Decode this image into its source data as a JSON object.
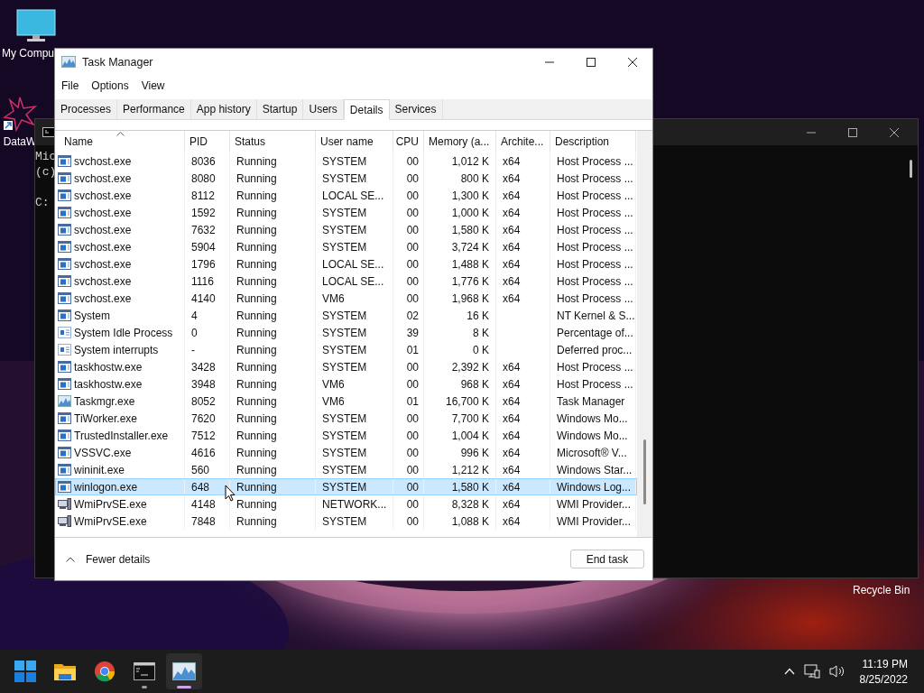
{
  "desktop": {
    "kind": "picture",
    "icons": [
      {
        "label": "My Compu",
        "kind": "monitor"
      },
      {
        "label": "DataW",
        "kind": "shortcut"
      },
      {
        "label": "Recycle Bin",
        "kind": "hidden"
      }
    ]
  },
  "console": {
    "lines": [
      "Mic",
      "(c)",
      "C:"
    ]
  },
  "task_manager": {
    "title": "Task Manager",
    "menu": [
      "File",
      "Options",
      "View"
    ],
    "tabs": [
      {
        "label": "Processes",
        "selected": false
      },
      {
        "label": "Performance",
        "selected": false
      },
      {
        "label": "App history",
        "selected": false
      },
      {
        "label": "Startup",
        "selected": false
      },
      {
        "label": "Users",
        "selected": false
      },
      {
        "label": "Details",
        "selected": true
      },
      {
        "label": "Services",
        "selected": false
      }
    ],
    "columns": [
      "Name",
      "PID",
      "Status",
      "User name",
      "CPU",
      "Memory (a...",
      "Archite...",
      "Description"
    ],
    "rows": [
      {
        "kind": "service",
        "name": "svchost.exe",
        "pid": "8036",
        "status": "Running",
        "user": "SYSTEM",
        "cpu": "00",
        "memory": "1,012 K",
        "arch": "x64",
        "description": "Host Process ...",
        "selected": false
      },
      {
        "kind": "service",
        "name": "svchost.exe",
        "pid": "8080",
        "status": "Running",
        "user": "SYSTEM",
        "cpu": "00",
        "memory": "800 K",
        "arch": "x64",
        "description": "Host Process ...",
        "selected": false
      },
      {
        "kind": "service",
        "name": "svchost.exe",
        "pid": "8112",
        "status": "Running",
        "user": "LOCAL SE...",
        "cpu": "00",
        "memory": "1,300 K",
        "arch": "x64",
        "description": "Host Process ...",
        "selected": false
      },
      {
        "kind": "service",
        "name": "svchost.exe",
        "pid": "1592",
        "status": "Running",
        "user": "SYSTEM",
        "cpu": "00",
        "memory": "1,000 K",
        "arch": "x64",
        "description": "Host Process ...",
        "selected": false
      },
      {
        "kind": "service",
        "name": "svchost.exe",
        "pid": "7632",
        "status": "Running",
        "user": "SYSTEM",
        "cpu": "00",
        "memory": "1,580 K",
        "arch": "x64",
        "description": "Host Process ...",
        "selected": false
      },
      {
        "kind": "service",
        "name": "svchost.exe",
        "pid": "5904",
        "status": "Running",
        "user": "SYSTEM",
        "cpu": "00",
        "memory": "3,724 K",
        "arch": "x64",
        "description": "Host Process ...",
        "selected": false
      },
      {
        "kind": "service",
        "name": "svchost.exe",
        "pid": "1796",
        "status": "Running",
        "user": "LOCAL SE...",
        "cpu": "00",
        "memory": "1,488 K",
        "arch": "x64",
        "description": "Host Process ...",
        "selected": false
      },
      {
        "kind": "service",
        "name": "svchost.exe",
        "pid": "1116",
        "status": "Running",
        "user": "LOCAL SE...",
        "cpu": "00",
        "memory": "1,776 K",
        "arch": "x64",
        "description": "Host Process ...",
        "selected": false
      },
      {
        "kind": "service",
        "name": "svchost.exe",
        "pid": "4140",
        "status": "Running",
        "user": "VM6",
        "cpu": "00",
        "memory": "1,968 K",
        "arch": "x64",
        "description": "Host Process ...",
        "selected": false
      },
      {
        "kind": "service",
        "name": "System",
        "pid": "4",
        "status": "Running",
        "user": "SYSTEM",
        "cpu": "02",
        "memory": "16 K",
        "description": "NT Kernel & S...",
        "selected": false
      },
      {
        "kind": "light",
        "name": "System Idle Process",
        "pid": "0",
        "status": "Running",
        "user": "SYSTEM",
        "cpu": "39",
        "memory": "8 K",
        "description": "Percentage of...",
        "selected": false
      },
      {
        "kind": "light",
        "name": "System interrupts",
        "pid": "-",
        "status": "Running",
        "user": "SYSTEM",
        "cpu": "01",
        "memory": "0 K",
        "description": "Deferred proc...",
        "selected": false
      },
      {
        "kind": "service",
        "name": "taskhostw.exe",
        "pid": "3428",
        "status": "Running",
        "user": "SYSTEM",
        "cpu": "00",
        "memory": "2,392 K",
        "arch": "x64",
        "description": "Host Process ...",
        "selected": false
      },
      {
        "kind": "service",
        "name": "taskhostw.exe",
        "pid": "3948",
        "status": "Running",
        "user": "VM6",
        "cpu": "00",
        "memory": "968 K",
        "arch": "x64",
        "description": "Host Process ...",
        "selected": false
      },
      {
        "kind": "chart",
        "name": "Taskmgr.exe",
        "pid": "8052",
        "status": "Running",
        "user": "VM6",
        "cpu": "01",
        "memory": "16,700 K",
        "arch": "x64",
        "description": "Task Manager",
        "selected": false
      },
      {
        "kind": "service",
        "name": "TiWorker.exe",
        "pid": "7620",
        "status": "Running",
        "user": "SYSTEM",
        "cpu": "00",
        "memory": "7,700 K",
        "arch": "x64",
        "description": "Windows Mo...",
        "selected": false
      },
      {
        "kind": "service",
        "name": "TrustedInstaller.exe",
        "pid": "7512",
        "status": "Running",
        "user": "SYSTEM",
        "cpu": "00",
        "memory": "1,004 K",
        "arch": "x64",
        "description": "Windows Mo...",
        "selected": false
      },
      {
        "kind": "service",
        "name": "VSSVC.exe",
        "pid": "4616",
        "status": "Running",
        "user": "SYSTEM",
        "cpu": "00",
        "memory": "996 K",
        "arch": "x64",
        "description": "Microsoft® V...",
        "selected": false
      },
      {
        "kind": "service",
        "name": "wininit.exe",
        "pid": "560",
        "status": "Running",
        "user": "SYSTEM",
        "cpu": "00",
        "memory": "1,212 K",
        "arch": "x64",
        "description": "Windows Star...",
        "selected": false
      },
      {
        "kind": "service",
        "name": "winlogon.exe",
        "pid": "648",
        "status": "Running",
        "user": "SYSTEM",
        "cpu": "00",
        "memory": "1,580 K",
        "arch": "x64",
        "description": "Windows Log...",
        "selected": true
      },
      {
        "kind": "machine",
        "name": "WmiPrvSE.exe",
        "pid": "4148",
        "status": "Running",
        "user": "NETWORK...",
        "cpu": "00",
        "memory": "8,328 K",
        "arch": "x64",
        "description": "WMI Provider...",
        "selected": false
      },
      {
        "kind": "machine",
        "name": "WmiPrvSE.exe",
        "pid": "7848",
        "status": "Running",
        "user": "SYSTEM",
        "cpu": "00",
        "memory": "1,088 K",
        "arch": "x64",
        "description": "WMI Provider...",
        "selected": false
      }
    ],
    "fewer_details": "Fewer details",
    "end_task": "End task"
  },
  "taskbar": {
    "apps": [
      {
        "kind": "start",
        "running": false,
        "active": false
      },
      {
        "kind": "folder",
        "running": false,
        "active": false
      },
      {
        "kind": "browser",
        "running": false,
        "active": false
      },
      {
        "kind": "terminal",
        "running": true,
        "active": false
      },
      {
        "kind": "chart",
        "running": true,
        "active": true
      }
    ],
    "time": "11:19 PM",
    "date": "8/25/2022"
  }
}
